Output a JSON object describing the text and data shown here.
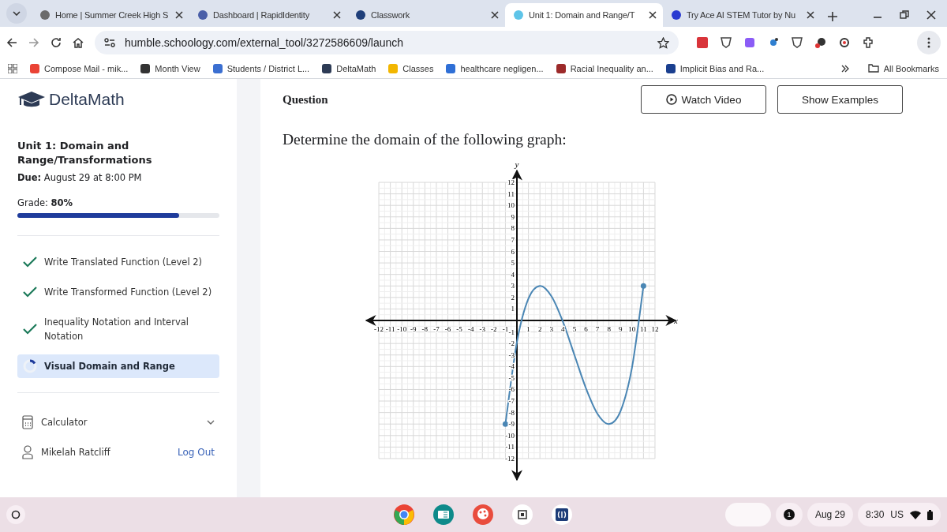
{
  "browser": {
    "tabs": [
      {
        "title": "Home | Summer Creek High S",
        "selected": false,
        "color": "#6b6b6b"
      },
      {
        "title": "Dashboard | RapidIdentity",
        "selected": false,
        "color": "#4a5fa8"
      },
      {
        "title": "Classwork",
        "selected": false,
        "color": "#1f3f7a"
      },
      {
        "title": "Unit 1: Domain and Range/T",
        "selected": true,
        "color": "#5ec4e8"
      },
      {
        "title": "Try Ace AI STEM Tutor by Nu",
        "selected": false,
        "color": "#2a3bd1"
      }
    ],
    "url": "humble.schoology.com/external_tool/3272586609/launch",
    "bookmarks": [
      {
        "title": "Compose Mail - mik...",
        "color": "#ea4335"
      },
      {
        "title": "Month View",
        "color": "#333333"
      },
      {
        "title": "Students / District L...",
        "color": "#3b6fd1"
      },
      {
        "title": "DeltaMath",
        "color": "#2d3b55"
      },
      {
        "title": "Classes",
        "color": "#f2b600"
      },
      {
        "title": "healthcare negligen...",
        "color": "#2f6fd6"
      },
      {
        "title": "Racial Inequality an...",
        "color": "#9c2a2a"
      },
      {
        "title": "Implicit Bias and Ra...",
        "color": "#1a3f8f"
      }
    ],
    "all_bookmarks": "All Bookmarks"
  },
  "sidebar": {
    "logo": "DeltaMath",
    "unit_title": "Unit 1: Domain and Range/Transformations",
    "due": "**Due:** August 29 at 8:00 PM",
    "grade": "Grade: **80%**",
    "grade_bar": {
      "level": 0.8
    },
    "skills": [
      {
        "label": "Write Translated Function (Level 2)",
        "kind": "done",
        "selected": false
      },
      {
        "label": "Write Transformed Function (Level 2)",
        "kind": "done",
        "selected": false
      },
      {
        "label": "Inequality Notation and Interval Notation",
        "kind": "done",
        "selected": false
      },
      {
        "label": "Visual Domain and Range",
        "kind": "in_progress",
        "selected": true
      }
    ],
    "calculator": "Calculator",
    "user": "Mikelah Ratcliff",
    "logout": "Log Out"
  },
  "main": {
    "heading": "Question",
    "buttons": [
      {
        "label": "Watch Video",
        "kind": "video"
      },
      {
        "label": "Show Examples",
        "kind": "plain"
      }
    ],
    "prompt": "Determine the domain of the following graph:",
    "chart_data": {
      "type": "line",
      "xlabel": "x",
      "ylabel": "y",
      "x": [
        -1,
        0,
        1,
        2,
        3,
        4,
        5,
        6,
        7,
        8,
        9,
        10,
        11
      ],
      "grid": true,
      "series": [
        {
          "color": "#4a86b4",
          "values": [
            -9,
            -1.89,
            1.89,
            3,
            2.11,
            -0.11,
            -3,
            -5.89,
            -8.11,
            -9,
            -7.89,
            -4.11,
            3
          ]
        }
      ],
      "xlim": [
        -12,
        12
      ],
      "ylim": [
        -12,
        12
      ],
      "xticks": [
        -12,
        -11,
        -10,
        -9,
        -8,
        -7,
        -6,
        -5,
        -4,
        -3,
        -2,
        -1,
        1,
        2,
        3,
        4,
        5,
        6,
        7,
        8,
        9,
        10,
        11,
        12
      ],
      "yticks": [
        -12,
        -11,
        -10,
        -9,
        -8,
        -7,
        -6,
        -5,
        -4,
        -3,
        -2,
        -1,
        1,
        2,
        3,
        4,
        5,
        6,
        7,
        8,
        9,
        10,
        11,
        12
      ]
    }
  },
  "taskbar": {
    "notification_count": "1",
    "date": "Aug 29",
    "time": "8:30",
    "input_method": "US"
  }
}
